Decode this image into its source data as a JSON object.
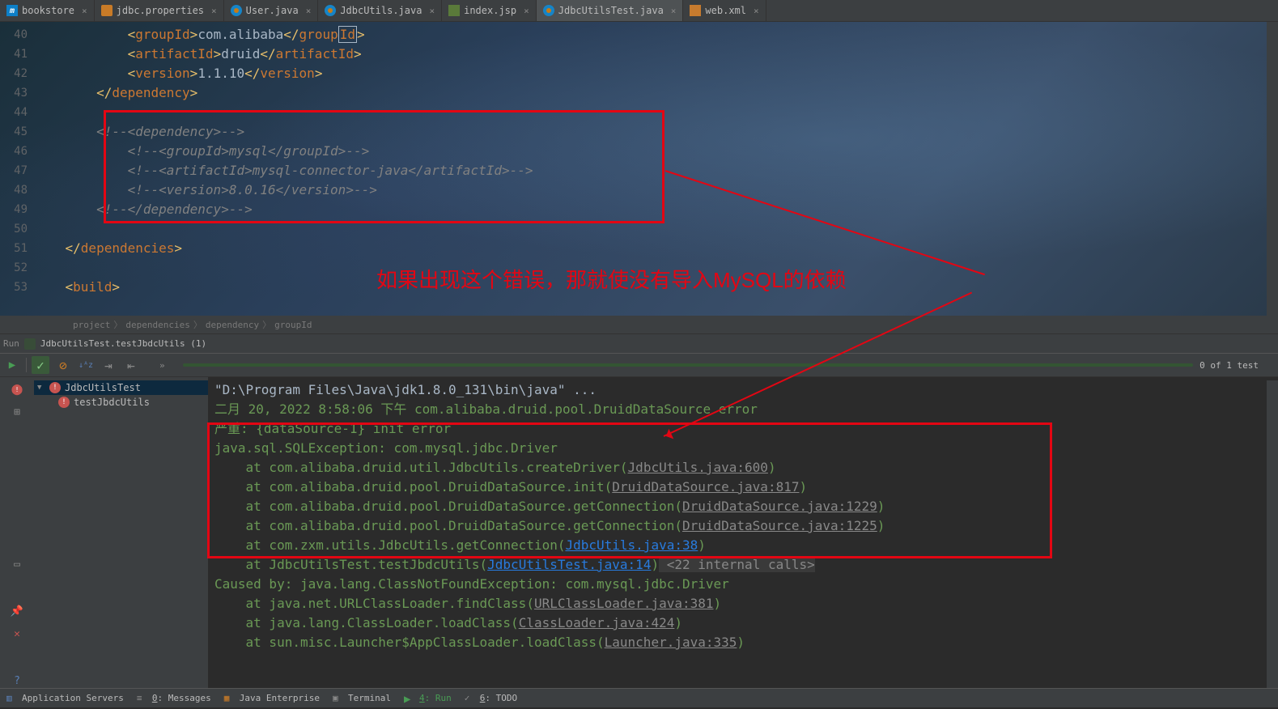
{
  "tabs": [
    {
      "label": "bookstore",
      "type": "m"
    },
    {
      "label": "jdbc.properties",
      "type": "props"
    },
    {
      "label": "User.java",
      "type": "java"
    },
    {
      "label": "JdbcUtils.java",
      "type": "java"
    },
    {
      "label": "index.jsp",
      "type": "jsp"
    },
    {
      "label": "JdbcUtilsTest.java",
      "type": "java",
      "active": true
    },
    {
      "label": "web.xml",
      "type": "xml"
    }
  ],
  "gutter": [
    "40",
    "41",
    "42",
    "43",
    "44",
    "45",
    "46",
    "47",
    "48",
    "49",
    "50",
    "51",
    "52",
    "53"
  ],
  "code": {
    "l40_pre": "            <",
    "l40_t1": "groupId",
    "l40_a": ">",
    "l40_v": "com.alibaba",
    "l40_b": "</",
    "l40_t2a": "group",
    "l40_t2b": "Id",
    "l40_c": ">",
    "l41_pre": "            <",
    "l41_t1": "artifactId",
    "l41_a": ">",
    "l41_v": "druid",
    "l41_b": "</",
    "l41_t2": "artifactId",
    "l41_c": ">",
    "l42_pre": "            <",
    "l42_t1": "version",
    "l42_a": ">",
    "l42_v": "1.1.10",
    "l42_b": "</",
    "l42_t2": "version",
    "l42_c": ">",
    "l43_pre": "        </",
    "l43_t": "dependency",
    "l43_a": ">",
    "l45": "        <!--<dependency>-->",
    "l46": "            <!--<groupId>mysql</groupId>-->",
    "l47": "            <!--<artifactId>mysql-connector-java</artifactId>-->",
    "l48": "            <!--<version>8.0.16</version>-->",
    "l49": "        <!--</dependency>-->",
    "l51_pre": "    </",
    "l51_t": "dependencies",
    "l51_a": ">",
    "l53_pre": "    <",
    "l53_t": "build",
    "l53_a": ">"
  },
  "breadcrumb": [
    "project",
    "dependencies",
    "dependency",
    "groupId"
  ],
  "run_header": "JdbcUtilsTest.testJbdcUtils (1)",
  "run_label": "Run",
  "test_status": "0 of 1 test",
  "tree": {
    "root": "JdbcUtilsTest",
    "child": "testJbdcUtils"
  },
  "console": {
    "l1": "\"D:\\Program Files\\Java\\jdk1.8.0_131\\bin\\java\" ...",
    "l2": "二月 20, 2022 8:58:06 下午 com.alibaba.druid.pool.DruidDataSource error",
    "l3": "严重: {dataSource-1} init error",
    "l4": "java.sql.SQLException: com.mysql.jdbc.Driver",
    "l5a": "    at com.alibaba.druid.util.JdbcUtils.createDriver(",
    "l5b": "JdbcUtils.java:600",
    "l5c": ")",
    "l6a": "    at com.alibaba.druid.pool.DruidDataSource.init(",
    "l6b": "DruidDataSource.java:817",
    "l6c": ")",
    "l7a": "    at com.alibaba.druid.pool.DruidDataSource.getConnection(",
    "l7b": "DruidDataSource.java:1229",
    "l7c": ")",
    "l8a": "    at com.alibaba.druid.pool.DruidDataSource.getConnection(",
    "l8b": "DruidDataSource.java:1225",
    "l8c": ")",
    "l9a": "    at com.zxm.utils.JdbcUtils.getConnection(",
    "l9b": "JdbcUtils.java:38",
    "l9c": ")",
    "l10a": "    at JdbcUtilsTest.testJbdcUtils(",
    "l10b": "JdbcUtilsTest.java:14",
    "l10c": ")",
    "l10d": " <22 internal calls>",
    "l11": "Caused by: java.lang.ClassNotFoundException: com.mysql.jdbc.Driver",
    "l12a": "    at java.net.URLClassLoader.findClass(",
    "l12b": "URLClassLoader.java:381",
    "l12c": ")",
    "l13a": "    at java.lang.ClassLoader.loadClass(",
    "l13b": "ClassLoader.java:424",
    "l13c": ")",
    "l14a": "    at sun.misc.Launcher$AppClassLoader.loadClass(",
    "l14b": "Launcher.java:335",
    "l14c": ")"
  },
  "annotation": "如果出现这个错误，那就使没有导入MySQL的依赖",
  "bottom": {
    "app_servers": "Application Servers",
    "messages": "0: Messages",
    "java_ee": "Java Enterprise",
    "terminal": "Terminal",
    "run": "4: Run",
    "todo": "6: TODO"
  }
}
